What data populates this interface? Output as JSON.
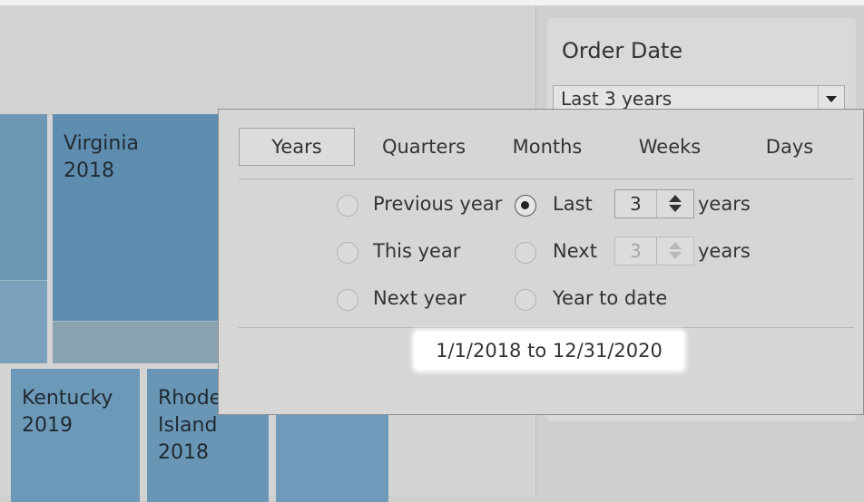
{
  "viz": {
    "tiles": [
      {
        "label": "Virginia\n2018"
      },
      {
        "label": "Kentucky\n2019"
      },
      {
        "label": "Rhode\nIsland\n2018"
      }
    ]
  },
  "filter_panel": {
    "title": "Order Date",
    "select_value": "Last 3 years"
  },
  "popup": {
    "tabs": [
      {
        "label": "Years",
        "active": true
      },
      {
        "label": "Quarters",
        "active": false
      },
      {
        "label": "Months",
        "active": false
      },
      {
        "label": "Weeks",
        "active": false
      },
      {
        "label": "Days",
        "active": false
      }
    ],
    "options": {
      "previous_year": "Previous year",
      "this_year": "This year",
      "next_year": "Next year",
      "last": "Last",
      "next": "Next",
      "year_to_date": "Year to date",
      "years_unit": "years",
      "last_value": "3",
      "next_value": "3"
    },
    "selected_option": "Last",
    "date_range": "1/1/2018 to 12/31/2020"
  },
  "colors": {
    "tile_blue": "#5f8db0",
    "highlight": "#ffffff"
  }
}
